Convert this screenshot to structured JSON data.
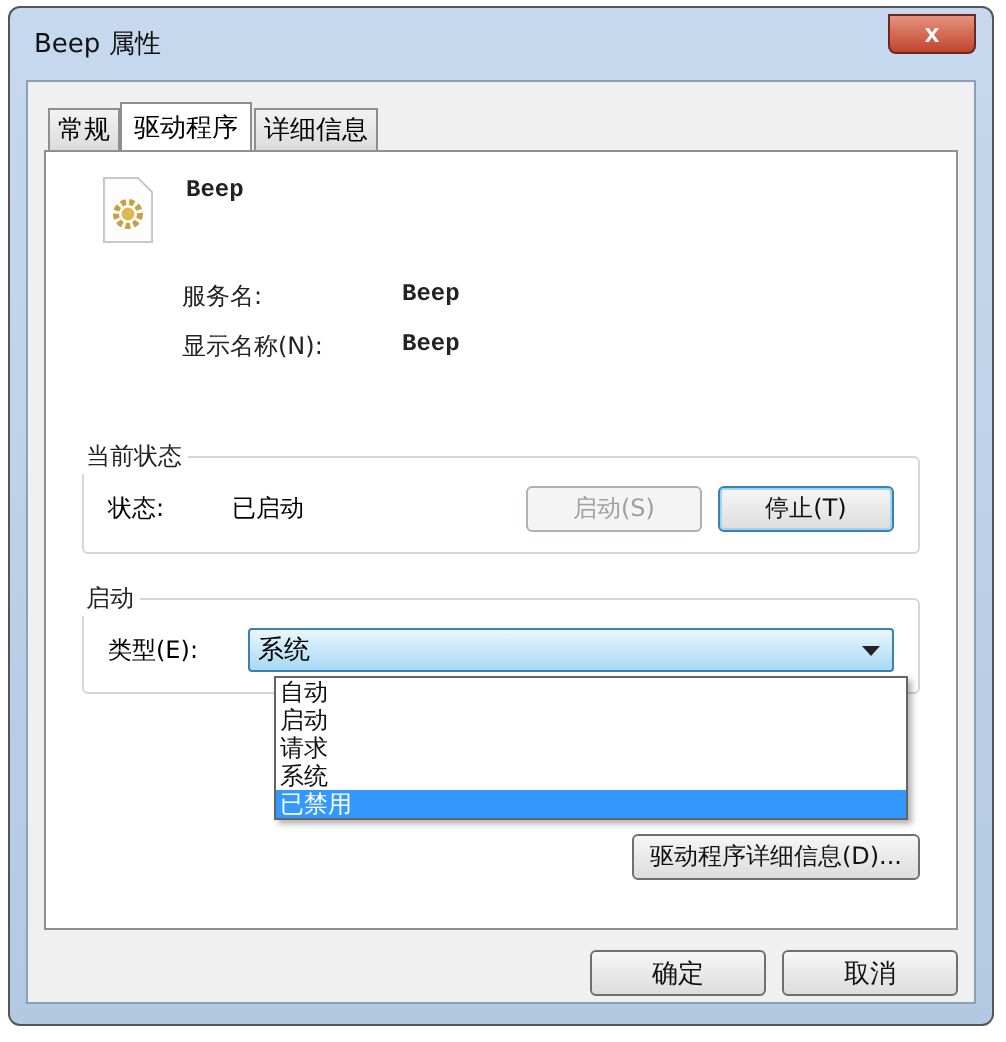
{
  "window": {
    "title": "Beep 属性",
    "close": "x"
  },
  "tabs": [
    {
      "label": "常规",
      "selected": false
    },
    {
      "label": "驱动程序",
      "selected": true
    },
    {
      "label": "详细信息",
      "selected": false
    }
  ],
  "driver": {
    "name": "Beep",
    "fields": [
      {
        "label": "服务名:",
        "value": "Beep"
      },
      {
        "label": "显示名称(N):",
        "value": "Beep"
      }
    ]
  },
  "current_status": {
    "title": "当前状态",
    "label": "状态:",
    "value": "已启动",
    "buttons": [
      {
        "label": "启动(S)",
        "disabled": true,
        "selected": false
      },
      {
        "label": "停止(T)",
        "disabled": false,
        "selected": true
      }
    ]
  },
  "startup": {
    "title": "启动",
    "label": "类型(E):",
    "value": "系统",
    "options": [
      {
        "label": "自动",
        "highlighted": false
      },
      {
        "label": "启动",
        "highlighted": false
      },
      {
        "label": "请求",
        "highlighted": false
      },
      {
        "label": "系统",
        "highlighted": false
      },
      {
        "label": "已禁用",
        "highlighted": true
      }
    ]
  },
  "details_button": "驱动程序详细信息(D)...",
  "buttons": [
    "确定",
    "取消"
  ]
}
